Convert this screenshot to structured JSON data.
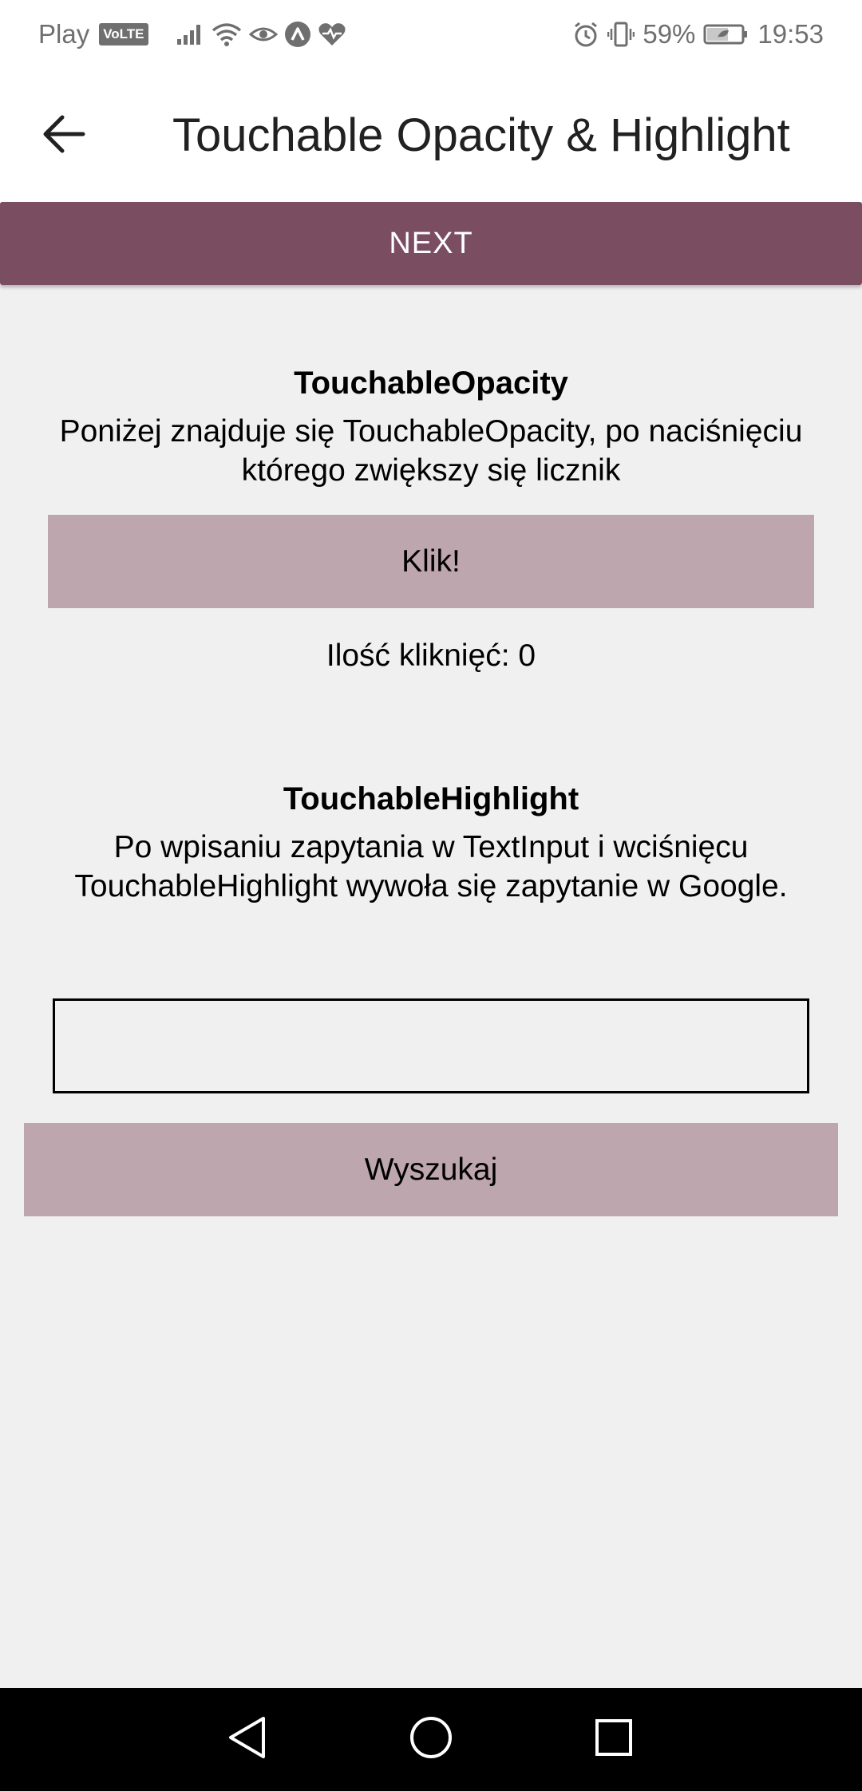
{
  "status_bar": {
    "carrier": "Play",
    "volte": "VoLTE",
    "battery_percent": "59%",
    "time": "19:53",
    "icons": [
      "signal-icon",
      "wifi-icon",
      "eye-icon",
      "app-icon",
      "heart-icon",
      "alarm-icon",
      "vibrate-icon",
      "battery-icon"
    ]
  },
  "app_bar": {
    "title": "Touchable Opacity & Highlight",
    "back_icon": "arrow-left-icon"
  },
  "next_button": {
    "label": "NEXT"
  },
  "opacity_section": {
    "title": "TouchableOpacity",
    "description": "Poniżej znajduje się TouchableOpacity, po naciśnięciu którego zwiększy się licznik",
    "button_label": "Klik!",
    "counter_text": "Ilość kliknięć: 0"
  },
  "highlight_section": {
    "title": "TouchableHighlight",
    "description": "Po wpisaniu zapytania w TextInput i wciśnięcu TouchableHighlight wywoła się zapytanie w Google.",
    "input_value": "",
    "button_label": "Wyszukaj"
  },
  "nav_bar": {
    "icons": [
      "nav-back-icon",
      "nav-home-icon",
      "nav-recents-icon"
    ]
  },
  "colors": {
    "primary": "#7b4d61",
    "button_pink": "#bea6ae",
    "background": "#f0f0f0"
  }
}
